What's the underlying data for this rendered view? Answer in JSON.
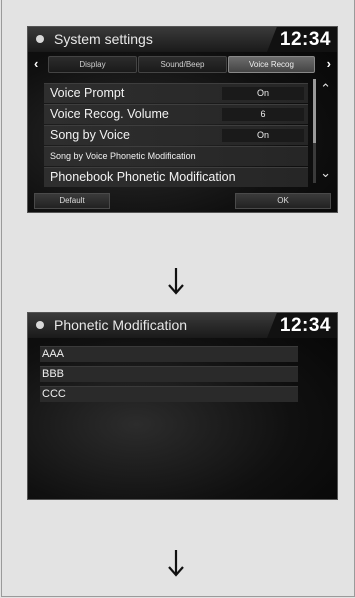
{
  "screen1": {
    "title": "System settings",
    "time": "12:34",
    "tabs": [
      "Display",
      "Sound/Beep",
      "Voice Recog"
    ],
    "active_tab": "Voice Recog",
    "rows": [
      {
        "label": "Voice Prompt",
        "value": "On"
      },
      {
        "label": "Voice Recog. Volume",
        "value": "6"
      },
      {
        "label": "Song by Voice",
        "value": "On"
      },
      {
        "label": "Song by Voice Phonetic Modification",
        "value": ""
      },
      {
        "label": "Phonebook Phonetic Modification",
        "value": ""
      }
    ],
    "default_label": "Default",
    "ok_label": "OK",
    "scroll_position": 0.0
  },
  "screen2": {
    "title": "Phonetic Modification",
    "time": "12:34",
    "items": [
      "AAA",
      "BBB",
      "CCC"
    ]
  },
  "colors": {
    "page_background": "#e3e3e3",
    "screen_background": "#111111",
    "accent": "#ffffff"
  }
}
